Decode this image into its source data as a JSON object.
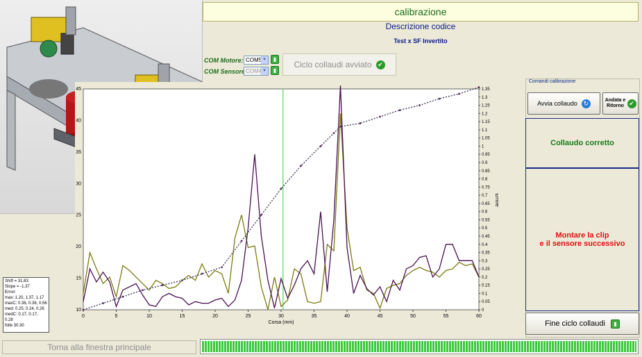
{
  "header": {
    "title": "calibrazione",
    "description": "Descrizione codice",
    "subtitle": "Test x SF Invertito"
  },
  "com": {
    "motor_label": "COM Motore:",
    "motor_value": "COM5",
    "sensor_label": "COM Sensore:",
    "sensor_value": "COM4"
  },
  "cycle_status": "Ciclo collaudi avviato",
  "commands": {
    "title": "Comandi calibrazione",
    "start_label": "Avvia collaudo",
    "roundtrip_label": "Andata e Ritorno",
    "result_text": "Collaudo corretto",
    "instruction_line1": "Montare la clip",
    "instruction_line2": "e il sensore successivo",
    "end_label": "Fine ciclo collaudi"
  },
  "stats": {
    "lines": [
      "Shift = 31.83",
      "Slope = -1.37",
      "Errori",
      "max: 1.20, 1.37, 1.17",
      "maxC: 0.36, 0.36, 0.56",
      "med: 0.25, 0.24, 0.26",
      "medC: 0.17, 0.17, 0.28",
      "folle 30.30"
    ]
  },
  "footer": {
    "back_label": "Torna alla finestra principale",
    "progress": 1.0
  },
  "colors": {
    "accent_green": "#2a9a2a",
    "result_green": "#1a7a1a",
    "instruction_red": "#e01010",
    "navy": "#0a1a88"
  },
  "chart_data": {
    "type": "line",
    "xlabel": "Corsa (mm)",
    "ylabel_right": "Errore",
    "xlim": [
      0,
      60
    ],
    "ylim_left": [
      10,
      45
    ],
    "ylim_right": [
      0,
      1.35
    ],
    "x_ticks": [
      0,
      5,
      10,
      15,
      20,
      25,
      30,
      35,
      40,
      45,
      50,
      55,
      60
    ],
    "y_left_ticks": [
      10,
      15,
      20,
      25,
      30,
      35,
      40,
      45
    ],
    "y_right_ticks": [
      0,
      0.05,
      0.1,
      0.15,
      0.2,
      0.25,
      0.3,
      0.35,
      0.4,
      0.45,
      0.5,
      0.55,
      0.6,
      0.65,
      0.7,
      0.75,
      0.8,
      0.85,
      0.9,
      0.95,
      1,
      1.05,
      1.1,
      1.15,
      1.2,
      1.25,
      1.3,
      1.35
    ],
    "marker_x": 30.3,
    "series": [
      {
        "color": "#7a7a10",
        "axis": "right",
        "x": [
          0,
          1,
          2,
          3,
          4,
          5,
          6,
          7,
          8,
          9,
          10,
          11,
          12,
          13,
          14,
          15,
          16,
          17,
          18,
          19,
          20,
          21,
          22,
          23,
          24,
          25,
          26,
          27,
          28,
          29,
          30,
          31,
          32,
          33,
          34,
          35,
          36,
          37,
          38,
          39,
          40,
          41,
          42,
          43,
          44,
          45,
          46,
          47,
          48,
          49,
          50,
          51,
          52,
          53,
          54,
          55,
          56,
          57,
          58,
          59,
          60
        ],
        "y": [
          0.1,
          0.35,
          0.25,
          0.16,
          0.2,
          0.08,
          0.27,
          0.24,
          0.2,
          0.16,
          0.12,
          0.18,
          0.16,
          0.13,
          0.14,
          0.18,
          0.21,
          0.18,
          0.28,
          0.2,
          0.24,
          0.22,
          0.1,
          0.44,
          0.58,
          0.38,
          0.39,
          0.14,
          0.0,
          0.2,
          0.02,
          0.06,
          0.25,
          0.22,
          0.05,
          0.04,
          0.05,
          0.4,
          0.36,
          1.2,
          0.5,
          0.24,
          0.26,
          0.12,
          0.1,
          0.01,
          0.13,
          0.15,
          0.16,
          0.21,
          0.24,
          0.26,
          0.24,
          0.23,
          0.2,
          0.24,
          0.25,
          0.29,
          0.27,
          0.28,
          0.2
        ]
      },
      {
        "color": "#4a1050",
        "axis": "right",
        "x": [
          0,
          1,
          2,
          3,
          4,
          5,
          6,
          7,
          8,
          9,
          10,
          11,
          12,
          13,
          14,
          15,
          16,
          17,
          18,
          19,
          20,
          21,
          22,
          23,
          24,
          25,
          26,
          27,
          28,
          29,
          30,
          31,
          32,
          33,
          34,
          35,
          36,
          37,
          38,
          39,
          40,
          41,
          42,
          43,
          44,
          45,
          46,
          47,
          48,
          49,
          50,
          51,
          52,
          53,
          54,
          55,
          56,
          57,
          58,
          59,
          60
        ],
        "y": [
          0.05,
          0.25,
          0.17,
          0.23,
          0.17,
          0.02,
          0.12,
          0.14,
          0.16,
          0.09,
          0.03,
          0.02,
          0.08,
          0.1,
          0.08,
          0.07,
          0.03,
          0.05,
          0.04,
          0.04,
          0.06,
          0.07,
          0.02,
          0.06,
          0.18,
          0.5,
          0.95,
          0.45,
          0.18,
          0.01,
          0.19,
          0.07,
          0.15,
          0.25,
          0.3,
          0.22,
          0.6,
          0.11,
          0.55,
          1.37,
          0.38,
          0.1,
          0.21,
          0.13,
          0.09,
          0.14,
          0.05,
          0.18,
          0.12,
          0.25,
          0.27,
          0.32,
          0.33,
          0.2,
          0.25,
          0.4,
          0.4,
          0.3,
          0.3,
          0.3,
          0.2
        ]
      },
      {
        "color": "#333355",
        "axis": "right",
        "dashed": true,
        "x": [
          0,
          3,
          6,
          9,
          12,
          15,
          18,
          21,
          24,
          27,
          30,
          33,
          36,
          38,
          39,
          42,
          45,
          48,
          51,
          54,
          57,
          60
        ],
        "y": [
          0.0,
          0.04,
          0.08,
          0.12,
          0.15,
          0.18,
          0.22,
          0.26,
          0.42,
          0.58,
          0.74,
          0.88,
          1.0,
          1.08,
          1.12,
          1.14,
          1.18,
          1.22,
          1.25,
          1.29,
          1.32,
          1.36
        ]
      }
    ]
  }
}
